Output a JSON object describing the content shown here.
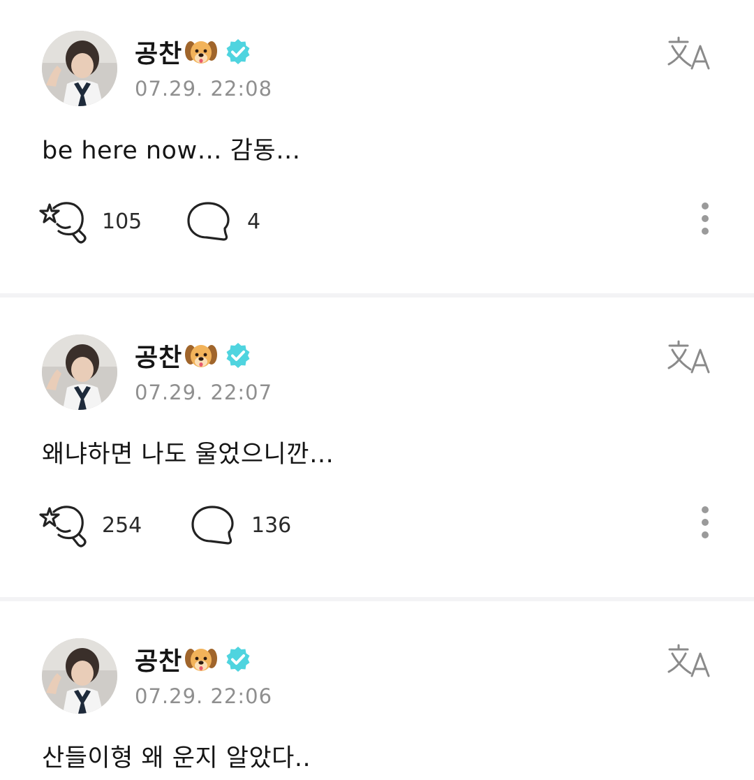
{
  "colors": {
    "verified": "#4fd4df",
    "text": "#151515",
    "muted": "#8f8f8f",
    "divider": "#f3f3f5"
  },
  "icons": {
    "react": "star-hand-icon",
    "comment": "speech-bubble-icon",
    "translate": "translate-icon",
    "more": "more-vertical-icon",
    "verified": "verified-badge-icon",
    "emoji": "dog-emoji-icon"
  },
  "posts": [
    {
      "author": "공찬",
      "time": "07.29. 22:08",
      "text": "be here now… 감동…",
      "reactions": "105",
      "comments": "4"
    },
    {
      "author": "공찬",
      "time": "07.29. 22:07",
      "text": "왜냐하면 나도 울었으니깐…",
      "reactions": "254",
      "comments": "136"
    },
    {
      "author": "공찬",
      "time": "07.29. 22:06",
      "text": "산들이형 왜 운지 알았다..",
      "reactions": "",
      "comments": ""
    }
  ]
}
